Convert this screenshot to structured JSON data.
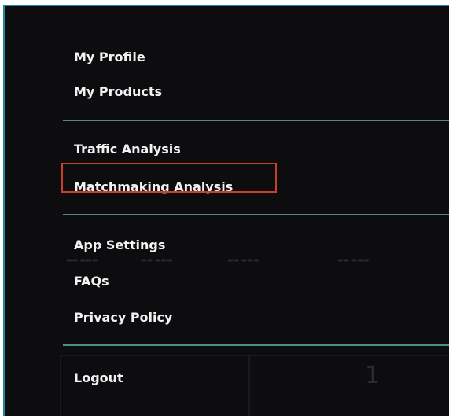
{
  "menu": {
    "items": [
      {
        "label": "My Profile"
      },
      {
        "label": "My Products"
      },
      {
        "label": "Traffic Analysis"
      },
      {
        "label": "Matchmaking Analysis"
      },
      {
        "label": "App Settings"
      },
      {
        "label": "FAQs"
      },
      {
        "label": "Privacy Policy"
      },
      {
        "label": "Logout"
      }
    ],
    "highlighted_item": "Matchmaking Analysis",
    "divider_color": "#4f8f80",
    "highlight_color": "#c8402c"
  },
  "background": {
    "stat_value": "1"
  }
}
